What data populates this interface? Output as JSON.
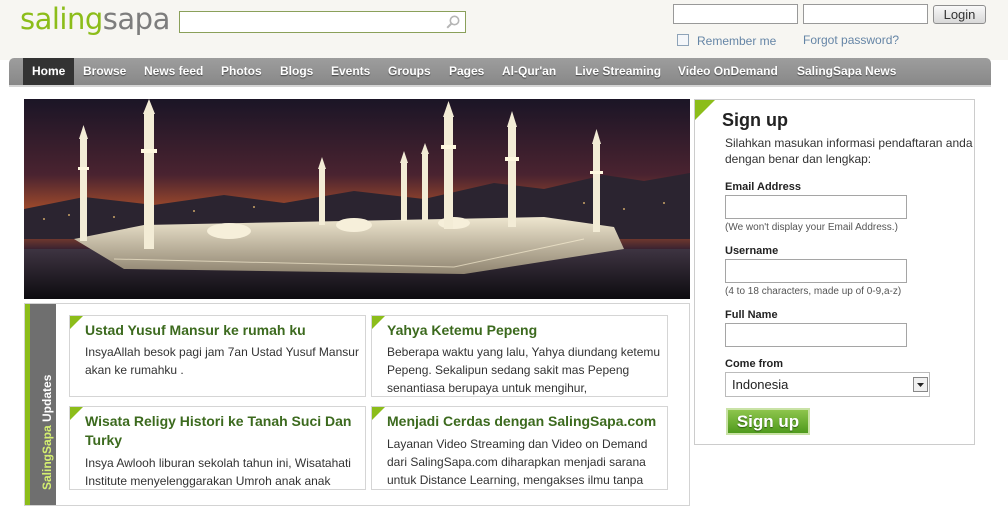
{
  "logo": {
    "part1": "saling",
    "part2": "sapa"
  },
  "search": {
    "value": "",
    "placeholder": ""
  },
  "login": {
    "email_value": "",
    "password_value": "",
    "button_label": "Login",
    "remember_label": "Remember me",
    "forgot_link": "Forgot password?"
  },
  "nav": {
    "items": [
      "Home",
      "Browse",
      "News feed",
      "Photos",
      "Blogs",
      "Events",
      "Groups",
      "Pages",
      "Al-Qur'an",
      "Live Streaming",
      "Video OnDemand",
      "SalingSapa News"
    ],
    "active": "Home"
  },
  "updates": {
    "title_part1": "SalingSapa",
    "title_part2": " Updates",
    "cards": [
      {
        "title": "Ustad Yusuf Mansur ke rumah ku",
        "body": [
          "InsyaAllah besok pagi jam 7an Ustad Yusuf Mansur",
          "akan ke rumahku ."
        ]
      },
      {
        "title": "Yahya Ketemu Pepeng",
        "body": [
          "Beberapa waktu yang lalu, Yahya diundang ketemu",
          "Pepeng. Sekalipun sedang sakit mas Pepeng",
          "senantiasa berupaya untuk mengihur,"
        ]
      },
      {
        "title": "Wisata Religy Histori ke Tanah Suci Dan Turky",
        "body": [
          "Insya Awlooh liburan sekolah tahun ini, Wisatahati",
          "Institute menyelenggarakan Umroh anak anak"
        ]
      },
      {
        "title": "Menjadi Cerdas dengan SalingSapa.com",
        "body": [
          "Layanan Video Streaming dan Video on Demand",
          "dari SalingSapa.com diharapkan menjadi sarana",
          "untuk Distance Learning, mengakses ilmu tanpa"
        ]
      }
    ]
  },
  "signup": {
    "title": "Sign up",
    "description": "Silahkan masukan informasi pendaftaran anda dengan benar dan lengkap:",
    "email_label": "Email Address",
    "email_value": "",
    "email_hint": "(We won't display your Email Address.)",
    "username_label": "Username",
    "username_value": "",
    "username_hint": "(4 to 18 characters, made up of 0-9,a-z)",
    "fullname_label": "Full Name",
    "fullname_value": "",
    "country_label": "Come from",
    "country_value": "Indonesia",
    "button_label": "Sign up"
  },
  "colors": {
    "brand_green": "#8cbd1a",
    "logo_gray": "#7d7d7d",
    "nav_gray": "#9d9d9d",
    "nav_active": "#333333",
    "card_title": "#3c6a1e",
    "signup_button": "#5aa326",
    "link_blue": "#6585a6"
  },
  "icons": {
    "search": "search-icon",
    "dropdown": "chevron-down-icon"
  }
}
